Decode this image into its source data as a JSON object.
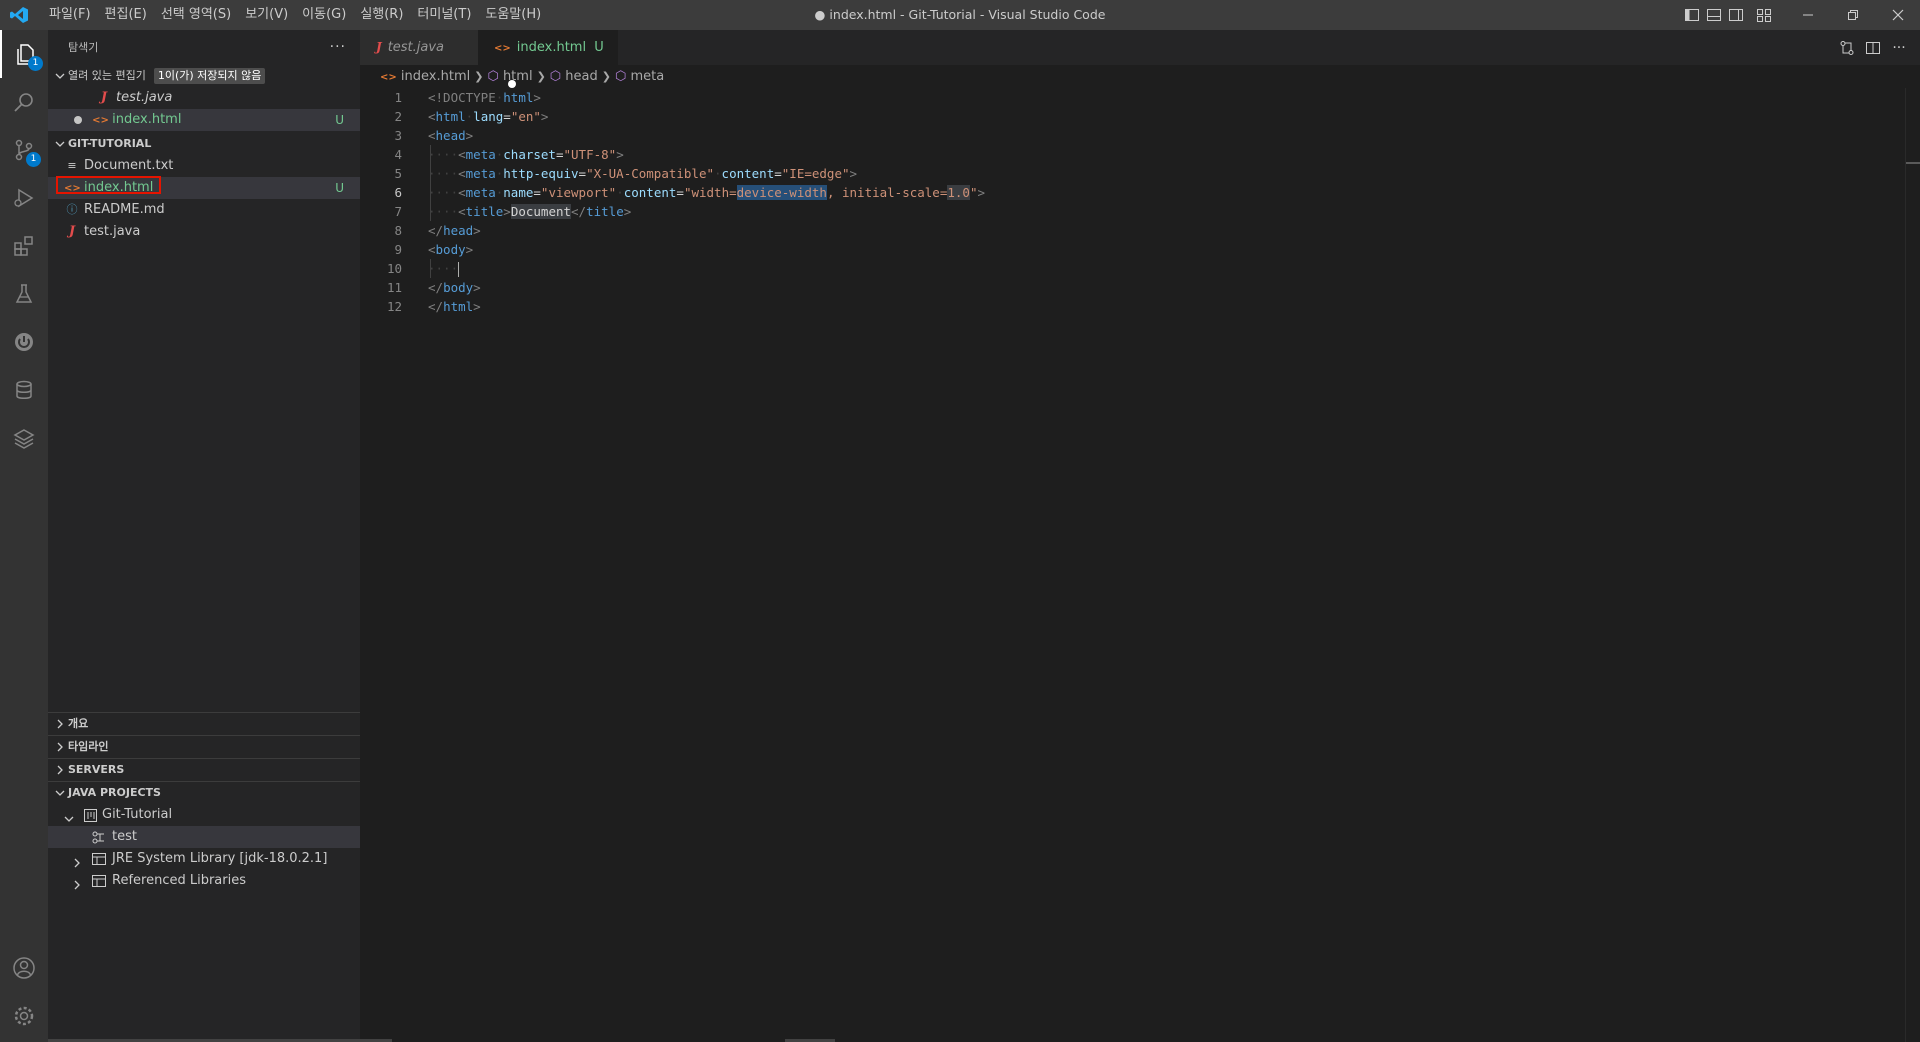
{
  "titlebar": {
    "menu": [
      "파일(F)",
      "편집(E)",
      "선택 영역(S)",
      "보기(V)",
      "이동(G)",
      "실행(R)",
      "터미널(T)",
      "도움말(H)"
    ],
    "title": "● index.html - Git-Tutorial - Visual Studio Code"
  },
  "activitybar": {
    "items": [
      "explorer-icon",
      "search-icon",
      "source-control-icon",
      "run-debug-icon",
      "extensions-icon",
      "testing-icon",
      "remote-icon",
      "database-icon",
      "layers-icon"
    ],
    "explorer_badge": "1",
    "scm_badge": "1",
    "bottom": [
      "account-icon",
      "settings-gear-icon"
    ]
  },
  "sidebar": {
    "title": "탐색기",
    "more": "···",
    "open_editors": {
      "label": "열려 있는 편집기",
      "badge": "1이(가) 저장되지 않음",
      "items": [
        {
          "name": "test.java",
          "status": ""
        },
        {
          "name": "index.html",
          "status": "U"
        }
      ]
    },
    "workspace": {
      "label": "GIT-TUTORIAL",
      "files": [
        {
          "name": "Document.txt",
          "status": ""
        },
        {
          "name": "index.html",
          "status": "U"
        },
        {
          "name": "README.md",
          "status": ""
        },
        {
          "name": "test.java",
          "status": ""
        }
      ]
    },
    "sections": [
      "개요",
      "타임라인",
      "SERVERS"
    ],
    "java_projects": {
      "label": "JAVA PROJECTS",
      "project": "Git-Tutorial",
      "children": [
        "test",
        "JRE System Library [jdk-18.0.2.1]",
        "Referenced Libraries"
      ]
    }
  },
  "editor": {
    "tabs": [
      {
        "label": "test.java",
        "status": ""
      },
      {
        "label": "index.html",
        "status": "U"
      }
    ],
    "breadcrumb": [
      "index.html",
      "html",
      "head",
      "meta"
    ],
    "line_numbers": [
      "1",
      "2",
      "3",
      "4",
      "5",
      "6",
      "7",
      "8",
      "9",
      "10",
      "11",
      "12"
    ],
    "current_line": "6",
    "code": {
      "l1_doctype": "<!DOCTYPE",
      "l1_html": "html",
      "l1_close": ">",
      "l2_open": "<",
      "l2_tag": "html",
      "l2_attr": "lang",
      "l2_val": "\"en\"",
      "l2_close": ">",
      "l3_tag": "head",
      "l4_tag": "meta",
      "l4_attr": "charset",
      "l4_val": "\"UTF-8\"",
      "l5_tag": "meta",
      "l5_attr1": "http-equiv",
      "l5_val1": "\"X-UA-Compatible\"",
      "l5_attr2": "content",
      "l5_val2": "\"IE=edge\"",
      "l6_tag": "meta",
      "l6_attr1": "name",
      "l6_val1": "\"viewport\"",
      "l6_attr2": "content",
      "l6_val2a": "\"width=",
      "l6_val2b": "device-width",
      "l6_val2c": ", initial-scale=",
      "l6_val2d": "1.0",
      "l6_val2e": "\"",
      "l7_tag": "title",
      "l7_text": "Document",
      "l7_endtag": "title",
      "l8_tag": "head",
      "l9_tag": "body",
      "l11_tag": "body",
      "l12_tag": "html"
    }
  },
  "colors": {
    "accent": "#007acc",
    "untracked": "#73c991",
    "highlight_box": "#e51400"
  }
}
